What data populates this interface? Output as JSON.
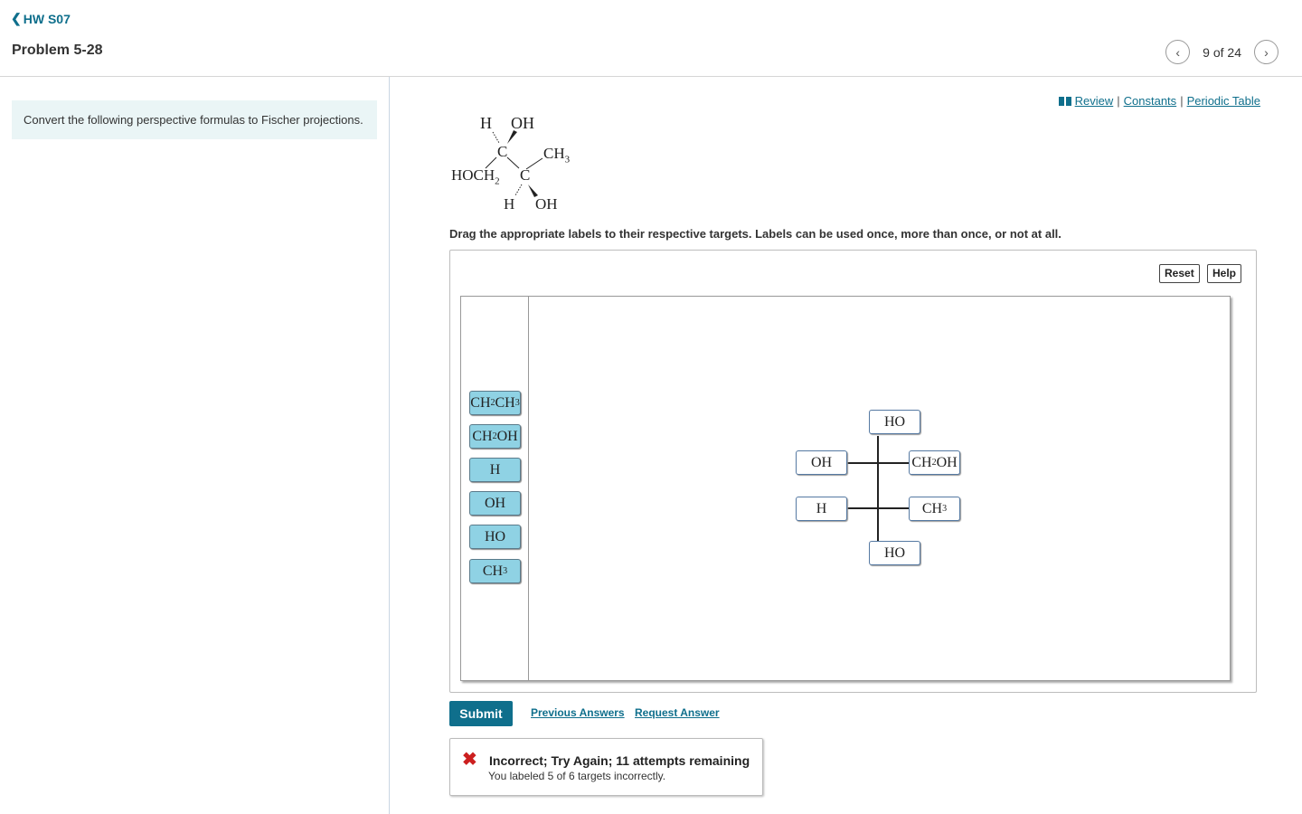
{
  "nav": {
    "back_label": "HW S07"
  },
  "problem_title": "Problem 5-28",
  "pager": {
    "position_text": "9 of 24",
    "prev_icon": "chevron-left-icon",
    "next_icon": "chevron-right-icon"
  },
  "intro_text": "Convert the following perspective formulas to Fischer projections.",
  "resources": {
    "review": "Review",
    "constants": "Constants",
    "periodic_table": "Periodic Table",
    "separator": "|"
  },
  "molecule": {
    "top_h": "H",
    "top_oh": "OH",
    "c1": "C",
    "ch3": "CH",
    "ch3_sub": "3",
    "hoch2": "HOCH",
    "hoch2_sub": "2",
    "c2": "C",
    "bottom_h": "H",
    "bottom_oh": "OH"
  },
  "instructions": "Drag the appropriate labels to their respective targets. Labels can be used once, more than once, or not at all.",
  "workspace": {
    "reset_label": "Reset",
    "help_label": "Help"
  },
  "labels": [
    {
      "main": "CH",
      "sub": "2",
      "rest": "CH",
      "sub2": "3"
    },
    {
      "main": "CH",
      "sub": "2",
      "rest": "OH",
      "sub2": ""
    },
    {
      "main": "H",
      "sub": "",
      "rest": "",
      "sub2": ""
    },
    {
      "main": "OH",
      "sub": "",
      "rest": "",
      "sub2": ""
    },
    {
      "main": "HO",
      "sub": "",
      "rest": "",
      "sub2": ""
    },
    {
      "main": "CH",
      "sub": "3",
      "rest": "",
      "sub2": ""
    }
  ],
  "targets": {
    "top": {
      "main": "HO",
      "sub": "",
      "rest": ""
    },
    "row1_left": {
      "main": "OH",
      "sub": "",
      "rest": ""
    },
    "row1_right": {
      "main": "CH",
      "sub": "2",
      "rest": "OH"
    },
    "row2_left": {
      "main": "H",
      "sub": "",
      "rest": ""
    },
    "row2_right": {
      "main": "CH",
      "sub": "3",
      "rest": ""
    },
    "bottom": {
      "main": "HO",
      "sub": "",
      "rest": ""
    }
  },
  "actions": {
    "submit": "Submit",
    "previous_answers": "Previous Answers",
    "request_answer": "Request Answer"
  },
  "feedback": {
    "icon": "x-icon",
    "title": "Incorrect; Try Again; 11 attempts remaining",
    "message": "You labeled 5 of 6 targets incorrectly.",
    "color": "#cc1f1f"
  },
  "colors": {
    "accent": "#0f6f8c",
    "label_fill": "#8fd2e4",
    "intro_bg": "#eaf5f6"
  }
}
